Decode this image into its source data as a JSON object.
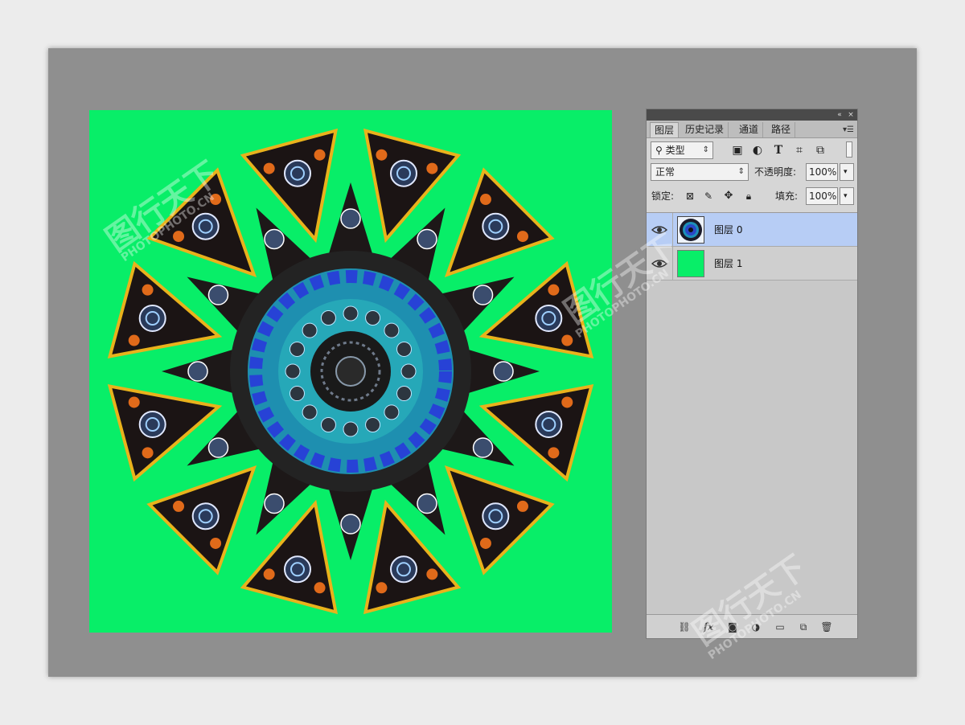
{
  "panel": {
    "tabs": [
      "图层",
      "历史记录",
      "通道",
      "路径"
    ],
    "filter": {
      "label": "类型"
    },
    "blend_mode": "正常",
    "opacity": {
      "label": "不透明度:",
      "value": "100%"
    },
    "lock": {
      "label": "锁定:"
    },
    "fill": {
      "label": "填充:",
      "value": "100%"
    },
    "layers": [
      {
        "name": "图层 0",
        "selected": true,
        "thumb": "mandala"
      },
      {
        "name": "图层 1",
        "selected": false,
        "thumb": "#08ee68"
      }
    ]
  },
  "watermark": {
    "logo": "图行天下",
    "text": "PHOTOPHOTO.CN"
  },
  "colors": {
    "canvas_bg": "#08ee68",
    "workspace": "#8f8f8f",
    "selected_layer": "#b7cdf5"
  },
  "icons": {
    "tools": [
      "image-filter-icon",
      "adjustment-filter-icon",
      "type-filter-icon",
      "shape-filter-icon",
      "smart-object-filter-icon"
    ],
    "lock": [
      "lock-transparent-icon",
      "lock-paint-icon",
      "lock-position-icon",
      "lock-all-icon"
    ],
    "bottom": [
      "link-icon",
      "fx-icon",
      "mask-icon",
      "adjustment-icon",
      "group-icon",
      "new-layer-icon",
      "delete-icon"
    ]
  }
}
